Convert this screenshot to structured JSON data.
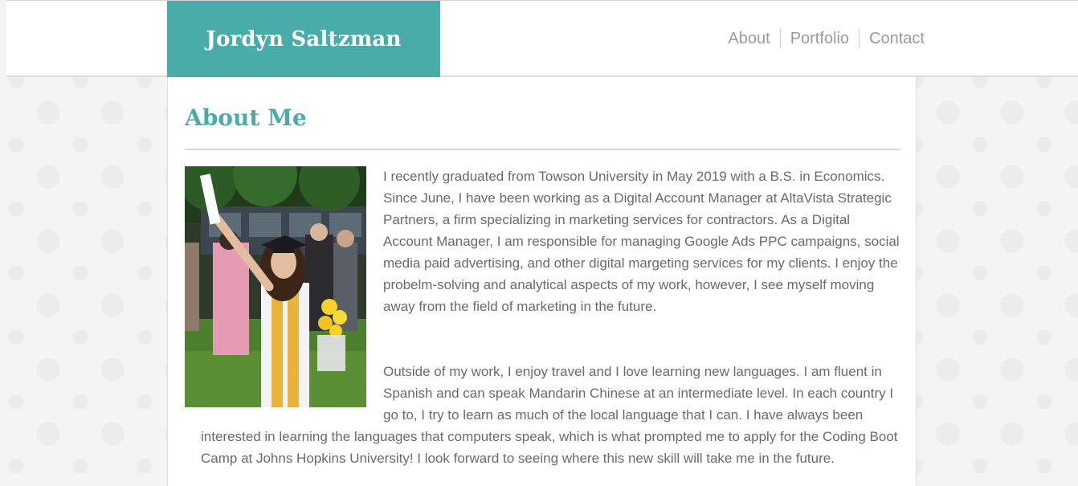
{
  "header": {
    "brand": "Jordyn Saltzman",
    "nav": [
      {
        "label": "About"
      },
      {
        "label": "Portfolio"
      },
      {
        "label": "Contact"
      }
    ]
  },
  "main": {
    "title": "About Me",
    "photo_icon": "graduation-photo",
    "paragraphs": [
      "I recently graduated from Towson University in May 2019 with a B.S. in Economics. Since June, I have been working as a Digital Account Manager at AltaVista Strategic Partners, a firm specializing in marketing services for contractors. As a Digital Account Manager, I am responsible for managing Google Ads PPC campaigns, social media paid advertising, and other digital margeting services for my clients. I enjoy the probelm-solving and analytical aspects of my work, however, I see myself moving away from the field of marketing in the future.",
      "Outside of my work, I enjoy travel and I love learning new languages. I am fluent in Spanish and can speak Mandarin Chinese at an intermediate level. In each country I go to, I try to learn as much of the local language that I can. I have always been interested in learning the languages that computers speak, which is what prompted me to apply for the Coding Boot Camp at Johns Hopkins University! I look forward to seeing where this new skill will take me in the future."
    ]
  },
  "colors": {
    "accent": "#4aaca8",
    "nav_text": "#9a9a9a",
    "body_text": "#6a6a6a"
  }
}
